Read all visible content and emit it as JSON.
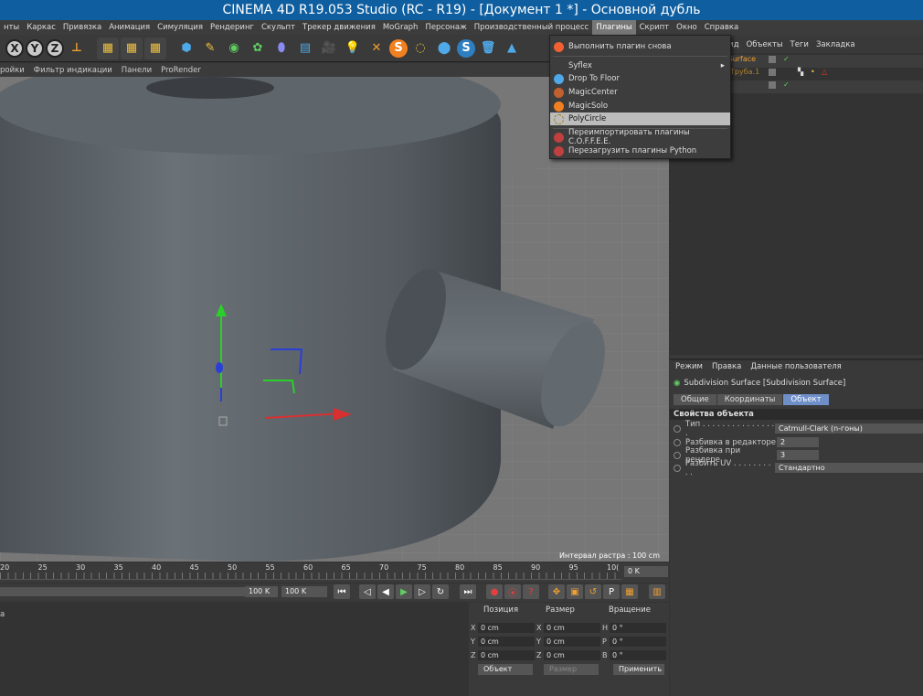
{
  "title": "CINEMA 4D R19.053 Studio (RC - R19) - [Документ 1 *] - Основной дубль",
  "menubar": [
    "нты",
    "Каркас",
    "Привязка",
    "Анимация",
    "Симуляция",
    "Рендеринг",
    "Скульпт",
    "Трекер движения",
    "MoGraph",
    "Персонаж",
    "Производственный процесс",
    "Плагины",
    "Скрипт",
    "Окно",
    "Справка"
  ],
  "menubar_active": "Плагины",
  "viewport_menu": [
    "ройки",
    "Фильтр индикации",
    "Панели",
    "ProRender"
  ],
  "viewport_status": "Интервал растра : 100 cm",
  "plugins_menu": {
    "run_again": "Выполнить плагин снова",
    "items": [
      "Syflex",
      "Drop To Floor",
      "MagicCenter",
      "MagicSolo",
      "PolyCircle"
    ],
    "highlighted": "PolyCircle",
    "reimport_coffee": "Переимпортировать плагины C.O.F.F.E.E.",
    "reload_python": "Перезагрузить плагины Python"
  },
  "object_manager": {
    "menu": [
      "ка",
      "Вид",
      "Объекты",
      "Теги",
      "Закладка"
    ],
    "rows": [
      {
        "label": "n Surface",
        "color": "#f0a030"
      },
      {
        "label": "Труба.1",
        "color": "#b08030"
      }
    ]
  },
  "attributes": {
    "menu": [
      "Режим",
      "Правка",
      "Данные пользователя"
    ],
    "object_title": "Subdivision Surface [Subdivision Surface]",
    "tabs": [
      "Общие",
      "Координаты",
      "Объект"
    ],
    "active_tab": "Объект",
    "section": "Свойства объекта",
    "props": [
      {
        "label": "Тип . . . . . . . . . . . . . . . .",
        "value": "Catmull-Clark (n-гоны)"
      },
      {
        "label": "Разбивка в редакторе",
        "value": "2"
      },
      {
        "label": "Разбивка при рендере",
        "value": "3"
      },
      {
        "label": "Разбить UV . . . . . . . . . .",
        "value": "Стандартно"
      }
    ]
  },
  "timeline": {
    "ticks": [
      "20",
      "25",
      "30",
      "35",
      "40",
      "45",
      "50",
      "55",
      "60",
      "65",
      "70",
      "75",
      "80",
      "85",
      "90",
      "95",
      "10("
    ],
    "current": "0 K",
    "end_field": "100 K",
    "end_field2": "100 K"
  },
  "coords": {
    "headers": [
      "Позиция",
      "Размер",
      "Вращение"
    ],
    "rows": [
      {
        "axis": "X",
        "pos": "0 cm",
        "sizeAxis": "X",
        "size": "0 cm",
        "rotAxis": "H",
        "rot": "0 °"
      },
      {
        "axis": "Y",
        "pos": "0 cm",
        "sizeAxis": "Y",
        "size": "0 cm",
        "rotAxis": "P",
        "rot": "0 °"
      },
      {
        "axis": "Z",
        "pos": "0 cm",
        "sizeAxis": "Z",
        "size": "0 cm",
        "rotAxis": "B",
        "rot": "0 °"
      }
    ],
    "mode": "Объект",
    "size_mode": "Размер",
    "apply": "Применить"
  },
  "bottom_left": "а"
}
